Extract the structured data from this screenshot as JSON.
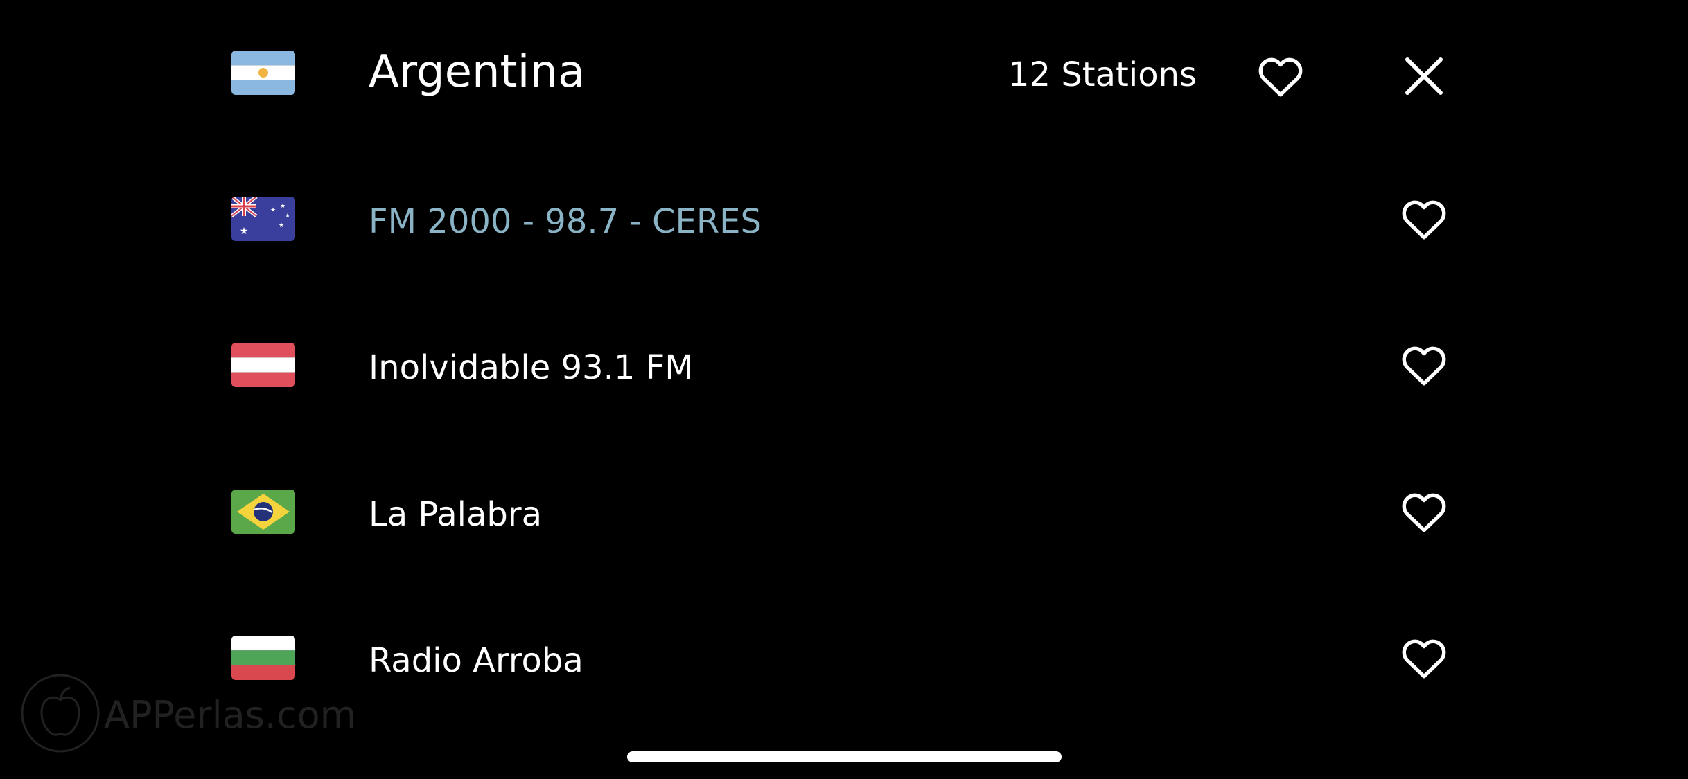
{
  "header": {
    "country_flag_icon": "argentina-flag-icon",
    "title": "Argentina",
    "station_count": "12 Stations",
    "favorite_icon": "heart-outline-icon",
    "close_icon": "close-x-icon"
  },
  "stations": [
    {
      "name": "FM 2000 - 98.7 - CERES",
      "flag_icon": "australia-flag-icon",
      "favorite_icon": "heart-outline-icon",
      "highlighted": true,
      "text_color": "#8ab4c6"
    },
    {
      "name": "Inolvidable 93.1 FM",
      "flag_icon": "austria-flag-icon",
      "favorite_icon": "heart-outline-icon",
      "highlighted": false,
      "text_color": "#ffffff"
    },
    {
      "name": "La Palabra",
      "flag_icon": "brazil-flag-icon",
      "favorite_icon": "heart-outline-icon",
      "highlighted": false,
      "text_color": "#ffffff"
    },
    {
      "name": "Radio Arroba",
      "flag_icon": "bulgaria-flag-icon",
      "favorite_icon": "heart-outline-icon",
      "highlighted": false,
      "text_color": "#ffffff"
    }
  ],
  "watermark": {
    "text": "APPerlas.com",
    "icon": "apple-logo-icon"
  },
  "colors": {
    "background": "#000000",
    "text": "#ffffff",
    "highlight_text": "#8ab4c6"
  }
}
